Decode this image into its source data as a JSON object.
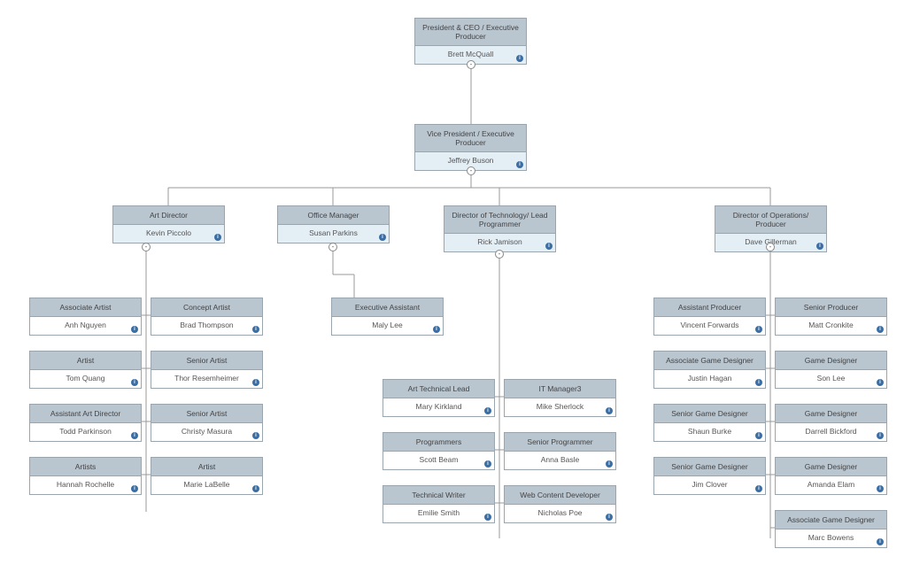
{
  "chart_data": {
    "type": "orgchart",
    "root": {
      "title": "President & CEO / Executive Producer",
      "name": "Brett McQuall",
      "children": [
        {
          "title": "Vice President / Executive Producer",
          "name": "Jeffrey Buson",
          "children": [
            {
              "title": "Art Director",
              "name": "Kevin Piccolo",
              "children": [
                {
                  "title": "Associate Artist",
                  "name": "Anh Nguyen"
                },
                {
                  "title": "Concept Artist",
                  "name": "Brad Thompson"
                },
                {
                  "title": "Artist",
                  "name": "Tom Quang"
                },
                {
                  "title": "Senior Artist",
                  "name": "Thor Resemheimer"
                },
                {
                  "title": "Assistant Art Director",
                  "name": "Todd Parkinson"
                },
                {
                  "title": "Senior Artist",
                  "name": "Christy Masura"
                },
                {
                  "title": "Artists",
                  "name": "Hannah Rochelle"
                },
                {
                  "title": "Artist",
                  "name": "Marie LaBelle"
                }
              ]
            },
            {
              "title": "Office Manager",
              "name": "Susan Parkins",
              "children": [
                {
                  "title": "Executive Assistant",
                  "name": "Maly Lee"
                }
              ]
            },
            {
              "title": "Director of Technology/ Lead Programmer",
              "name": "Rick Jamison",
              "children": [
                {
                  "title": "Art Technical Lead",
                  "name": "Mary Kirkland"
                },
                {
                  "title": "IT Manager3",
                  "name": "Mike Sherlock"
                },
                {
                  "title": "Programmers",
                  "name": "Scott Beam"
                },
                {
                  "title": "Senior Programmer",
                  "name": "Anna Basle"
                },
                {
                  "title": "Technical Writer",
                  "name": "Emilie Smith"
                },
                {
                  "title": "Web Content Developer",
                  "name": "Nicholas Poe"
                }
              ]
            },
            {
              "title": "Director of Operations/ Producer",
              "name": "Dave Gillerman",
              "children": [
                {
                  "title": "Assistant Producer",
                  "name": "Vincent Forwards"
                },
                {
                  "title": "Senior Producer",
                  "name": "Matt Cronkite"
                },
                {
                  "title": "Associate Game Designer",
                  "name": "Justin Hagan"
                },
                {
                  "title": "Game Designer",
                  "name": "Son Lee"
                },
                {
                  "title": "Senior Game Designer",
                  "name": "Shaun Burke"
                },
                {
                  "title": "Game Designer",
                  "name": "Darrell Bickford"
                },
                {
                  "title": "Senior Game Designer",
                  "name": "Jim Clover"
                },
                {
                  "title": "Game Designer",
                  "name": "Amanda Elam"
                },
                {
                  "title": "Associate Game Designer",
                  "name": "Marc Bowens"
                }
              ]
            }
          ]
        }
      ]
    }
  },
  "nodes": {
    "ceo": {
      "title": "President & CEO / Executive Producer",
      "name": "Brett McQuall"
    },
    "vp": {
      "title": "Vice President / Executive Producer",
      "name": "Jeffrey Buson"
    },
    "art_dir": {
      "title": "Art Director",
      "name": "Kevin Piccolo"
    },
    "office_mgr": {
      "title": "Office Manager",
      "name": "Susan Parkins"
    },
    "tech_dir": {
      "title": "Director of Technology/ Lead Programmer",
      "name": "Rick Jamison"
    },
    "ops_dir": {
      "title": "Director of Operations/ Producer",
      "name": "Dave Gillerman"
    },
    "art": [
      {
        "title": "Associate Artist",
        "name": "Anh Nguyen"
      },
      {
        "title": "Concept Artist",
        "name": "Brad Thompson"
      },
      {
        "title": "Artist",
        "name": "Tom Quang"
      },
      {
        "title": "Senior Artist",
        "name": "Thor Resemheimer"
      },
      {
        "title": "Assistant Art Director",
        "name": "Todd Parkinson"
      },
      {
        "title": "Senior Artist",
        "name": "Christy Masura"
      },
      {
        "title": "Artists",
        "name": "Hannah Rochelle"
      },
      {
        "title": "Artist",
        "name": "Marie LaBelle"
      }
    ],
    "office": [
      {
        "title": "Executive Assistant",
        "name": "Maly Lee"
      }
    ],
    "tech": [
      {
        "title": "Art Technical Lead",
        "name": "Mary Kirkland"
      },
      {
        "title": "IT Manager3",
        "name": "Mike Sherlock"
      },
      {
        "title": "Programmers",
        "name": "Scott Beam"
      },
      {
        "title": "Senior Programmer",
        "name": "Anna Basle"
      },
      {
        "title": "Technical Writer",
        "name": "Emilie Smith"
      },
      {
        "title": "Web Content Developer",
        "name": "Nicholas Poe"
      }
    ],
    "ops": [
      {
        "title": "Assistant Producer",
        "name": "Vincent Forwards"
      },
      {
        "title": "Senior Producer",
        "name": "Matt Cronkite"
      },
      {
        "title": "Associate Game Designer",
        "name": "Justin Hagan"
      },
      {
        "title": "Game Designer",
        "name": "Son Lee"
      },
      {
        "title": "Senior Game Designer",
        "name": "Shaun Burke"
      },
      {
        "title": "Game Designer",
        "name": "Darrell Bickford"
      },
      {
        "title": "Senior Game Designer",
        "name": "Jim Clover"
      },
      {
        "title": "Game Designer",
        "name": "Amanda Elam"
      },
      {
        "title": "Associate Game Designer",
        "name": "Marc Bowens"
      }
    ]
  }
}
